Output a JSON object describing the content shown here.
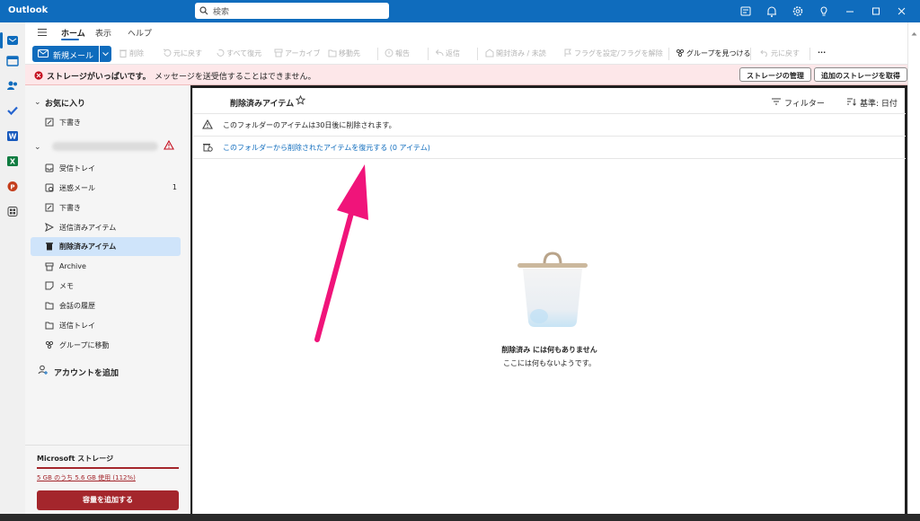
{
  "titlebar": {
    "app_title": "Outlook",
    "search_placeholder": "検索"
  },
  "tabs": [
    {
      "label": "ホーム",
      "active": true
    },
    {
      "label": "表示",
      "active": false
    },
    {
      "label": "ヘルプ",
      "active": false
    }
  ],
  "ribbon": {
    "new_mail": "新規メール",
    "delete": "削除",
    "restore": "元に戻す",
    "restore_all": "すべて復元",
    "archive": "アーカイブ",
    "move": "移動先",
    "report": "報告",
    "reply": "返信",
    "read_unread": "開封済み / 未読",
    "flag": "フラグを設定/フラグを解除",
    "find_groups": "グループを見つける",
    "undo": "元に戻す",
    "more": "···"
  },
  "alert": {
    "title": "ストレージがいっぱいです。",
    "message": "メッセージを送受信することはできません。",
    "manage_button": "ストレージの管理",
    "add_button": "追加のストレージを取得"
  },
  "sidebar": {
    "favorites_label": "お気に入り",
    "favorites": [
      {
        "label": "下書き",
        "icon": "pencil-icon"
      }
    ],
    "account_folders": [
      {
        "label": "受信トレイ",
        "icon": "inbox-icon",
        "count": ""
      },
      {
        "label": "迷惑メール",
        "icon": "junk-icon",
        "count": "1"
      },
      {
        "label": "下書き",
        "icon": "pencil-icon",
        "count": ""
      },
      {
        "label": "送信済みアイテム",
        "icon": "send-icon",
        "count": ""
      },
      {
        "label": "削除済みアイテム",
        "icon": "trash-icon",
        "count": "",
        "selected": true
      },
      {
        "label": "Archive",
        "icon": "archive-icon",
        "count": ""
      },
      {
        "label": "メモ",
        "icon": "note-icon",
        "count": ""
      },
      {
        "label": "会話の履歴",
        "icon": "folder-icon",
        "count": ""
      },
      {
        "label": "送信トレイ",
        "icon": "folder-icon",
        "count": ""
      },
      {
        "label": "グループに移動",
        "icon": "groups-icon",
        "count": ""
      }
    ],
    "add_account": "アカウントを追加",
    "storage": {
      "title": "Microsoft ストレージ",
      "usage": "5 GB のうち 5.6 GB 使用 (112%)",
      "used_percent": 112,
      "button": "容量を追加する"
    }
  },
  "content": {
    "folder_title": "削除済みアイテム",
    "filter_label": "フィルター",
    "sort_label": "基準: 日付",
    "info_row": "このフォルダーのアイテムは30日後に削除されます。",
    "recover_link": "このフォルダーから削除されたアイテムを復元する (0 アイテム)",
    "empty_title": "削除済み には何もありません",
    "empty_subtitle": "ここには何もないようです。"
  },
  "colors": {
    "brand": "#0f6cbd",
    "alert_bg": "#fde7e9",
    "storage_red": "#a4262c",
    "annotation_arrow": "#f0147a"
  }
}
